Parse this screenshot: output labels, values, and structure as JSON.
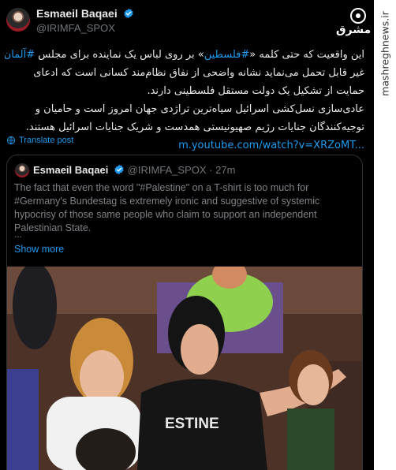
{
  "tweet": {
    "author_name": "Esmaeil Baqaei",
    "author_handle": "@IRIMFA_SPOX",
    "body": {
      "line1_prefix": "این واقعیت که حتی کلمه «",
      "line1_hashtag1": "#فلسطین",
      "line1_middle": "» بر روی لباس یک نماینده برای مجلس ",
      "line1_hashtag2": "#آلمان",
      "line2": "غیر قابل تحمل می‌نماید نشانه واضحی از نفاق نظام‌مند کسانی است که ادعای",
      "line3": "حمایت از تشکیل یک دولت مستقل فلسطینی دارند.",
      "line4": "عادی‌سازی نسل‌کشی اسرائیل سیاه‌ترین تراژدی جهان امروز است و حامیان و",
      "line5": "توجیه‌کنندگان جنایات رژیم صهیونیستی همدست و شریک جنایات اسرائیل هستند.",
      "link": "m.youtube.com/watch?v=XRZoMT..."
    },
    "translate_label": "Translate post"
  },
  "quote": {
    "author_name": "Esmaeil Baqaei",
    "author_handle": "@IRIMFA_SPOX",
    "time": "27m",
    "text": "The fact that even the word \"#Palestine\" on a T-shirt is too much for #Germany's Bundestag is extremely ironic and suggestive of systemic hypocrisy of those same people who claim to support an independent Palestinian State.",
    "ellipsis": "...",
    "show_more": "Show more",
    "shirt_text": "ESTINE"
  },
  "overlay": {
    "logo_text": "مشرق",
    "watermark": "mashreghnews.ir"
  },
  "colors": {
    "background": "#000000",
    "link_blue": "#1d9bf0",
    "muted": "#71767b",
    "verified": "#1d9bf0",
    "border": "#2f3336"
  },
  "icons": [
    "verified-badge-icon",
    "globe-icon",
    "mashregh-logo-icon"
  ]
}
